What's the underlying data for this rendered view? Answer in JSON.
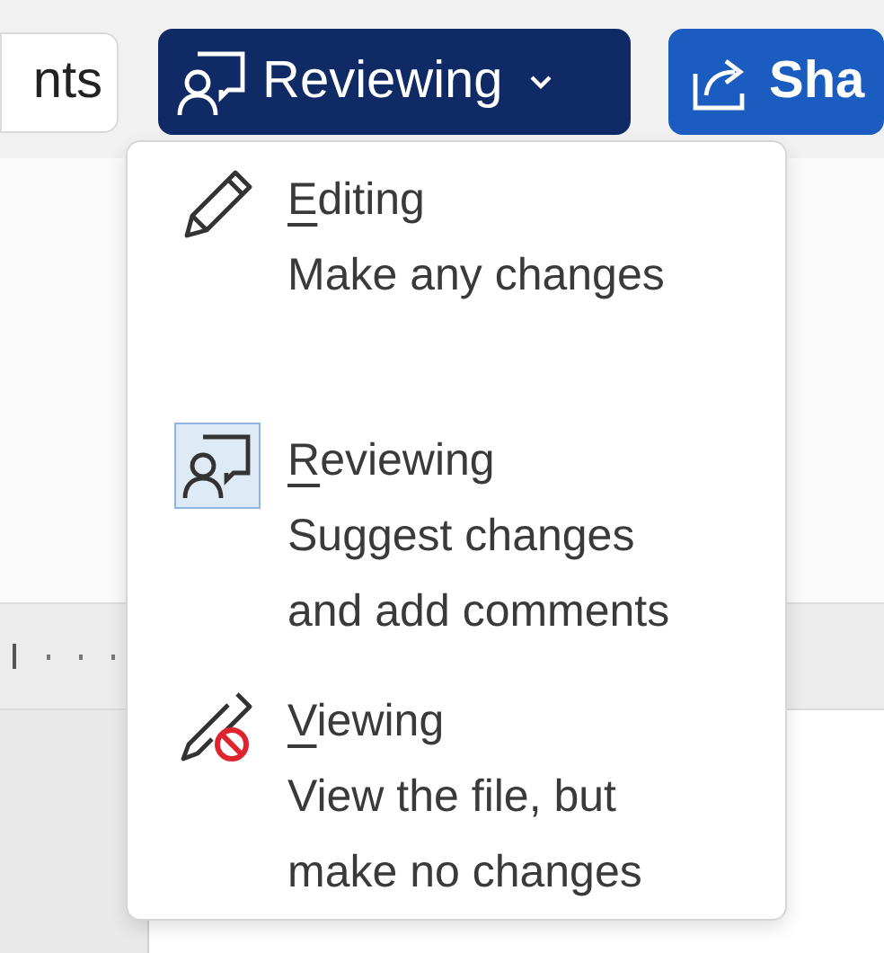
{
  "toolbar": {
    "left_button": {
      "label": "nts"
    },
    "mode_button": {
      "label": "Reviewing",
      "expanded": true
    },
    "share_button": {
      "label": "Sha"
    }
  },
  "mode_menu": {
    "items": [
      {
        "kind": "editing",
        "title": "Editing",
        "description": [
          "Make any changes"
        ],
        "selected": false
      },
      {
        "kind": "reviewing",
        "title": "Reviewing",
        "description": [
          "Suggest changes",
          "and add comments"
        ],
        "selected": true
      },
      {
        "kind": "viewing",
        "title": "Viewing",
        "description": [
          "View the file, but",
          "make no changes"
        ],
        "selected": false
      }
    ]
  }
}
